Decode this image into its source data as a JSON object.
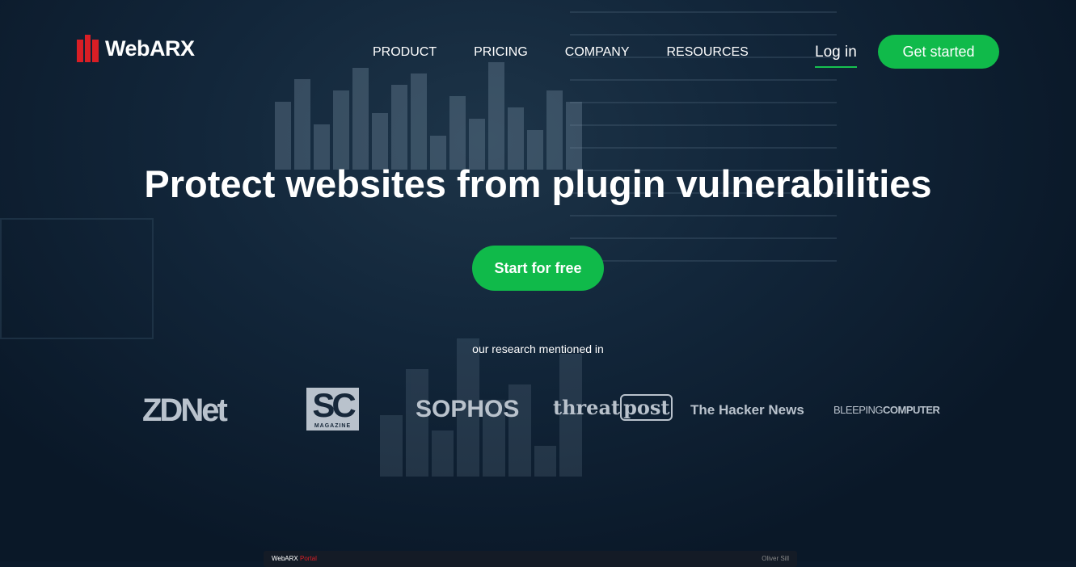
{
  "brand": {
    "name": "WebARX",
    "accent": "#10ba4a",
    "logo_color": "#d91e25"
  },
  "nav": {
    "items": [
      "PRODUCT",
      "PRICING",
      "COMPANY",
      "RESOURCES"
    ],
    "login": "Log in",
    "get_started": "Get started"
  },
  "hero": {
    "title": "Protect websites from plugin vulnerabilities",
    "cta": "Start for free",
    "mentioned": "our research mentioned in"
  },
  "press": {
    "zdnet": "ZDNet",
    "sc": "SC",
    "sc_sub": "MAGAZINE",
    "sophos": "SOPHOS",
    "threat": "threat",
    "post": "post",
    "thn": "The Hacker News",
    "bleeping": "BLEEPING",
    "computer": "COMPUTER"
  },
  "portal": {
    "brand": "WebARX",
    "label": "Portal",
    "user": "Oliver Sill"
  }
}
